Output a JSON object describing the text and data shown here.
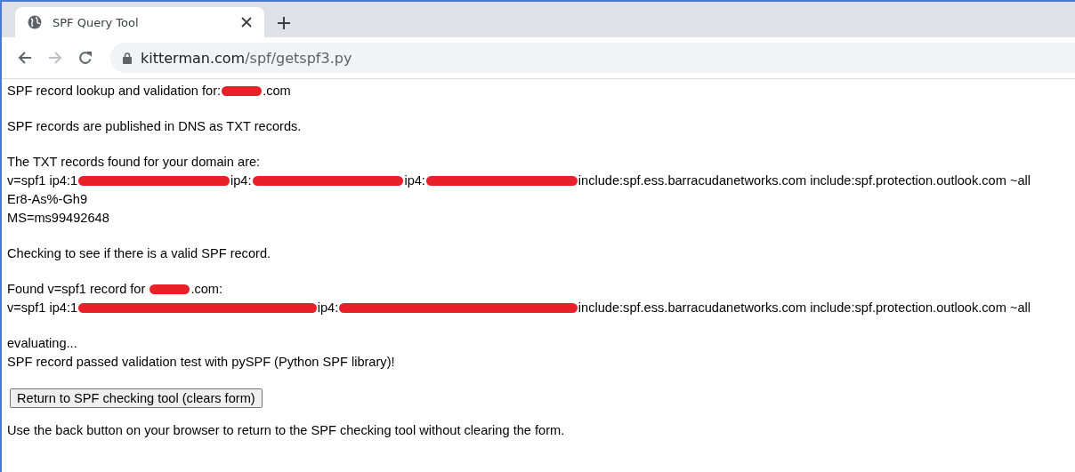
{
  "browser": {
    "tab": {
      "title": "SPF Query Tool",
      "selected": true
    },
    "address": {
      "host": "kitterman.com",
      "path": "/spf/getspf3.py"
    }
  },
  "content": {
    "paragraphs": [
      {
        "lines": [
          [
            {
              "text": "SPF record lookup and validation for:"
            },
            {
              "kind": "redaction"
            },
            {
              "text": ".com"
            }
          ]
        ]
      },
      {
        "lines": [
          [
            {
              "text": "SPF records are published in DNS as TXT records."
            }
          ]
        ]
      },
      {
        "lines": [
          [
            {
              "text": "The TXT records found for your domain are:"
            }
          ],
          [
            {
              "text": "v=spf1 ip4:1"
            },
            {
              "kind": "redaction"
            },
            {
              "text": "ip4:"
            },
            {
              "kind": "redaction"
            },
            {
              "text": "ip4:"
            },
            {
              "kind": "redaction"
            },
            {
              "text": "include:spf.ess.barracudanetworks.com include:spf.protection.outlook.com ~all"
            }
          ],
          [
            {
              "text": "Er8-As%-Gh9"
            }
          ],
          [
            {
              "text": "MS=ms99492648"
            }
          ]
        ]
      },
      {
        "lines": [
          [
            {
              "text": "Checking to see if there is a valid SPF record."
            }
          ]
        ]
      },
      {
        "lines": [
          [
            {
              "text": "Found v=spf1 record for "
            },
            {
              "kind": "redaction"
            },
            {
              "text": ".com:"
            }
          ],
          [
            {
              "text": "v=spf1 ip4:1"
            },
            {
              "kind": "redaction"
            },
            {
              "text": "ip4:"
            },
            {
              "kind": "redaction"
            },
            {
              "text": "include:spf.ess.barracudanetworks.com include:spf.protection.outlook.com ~all"
            }
          ]
        ]
      },
      {
        "lines": [
          [
            {
              "text": "evaluating..."
            }
          ],
          [
            {
              "text": "SPF record passed validation test with pySPF (Python SPF library)!"
            }
          ]
        ]
      }
    ],
    "button": "Return to SPF checking tool (clears form)",
    "note": "Use the back button on your browser to return to the SPF checking tool without clearing the form."
  }
}
